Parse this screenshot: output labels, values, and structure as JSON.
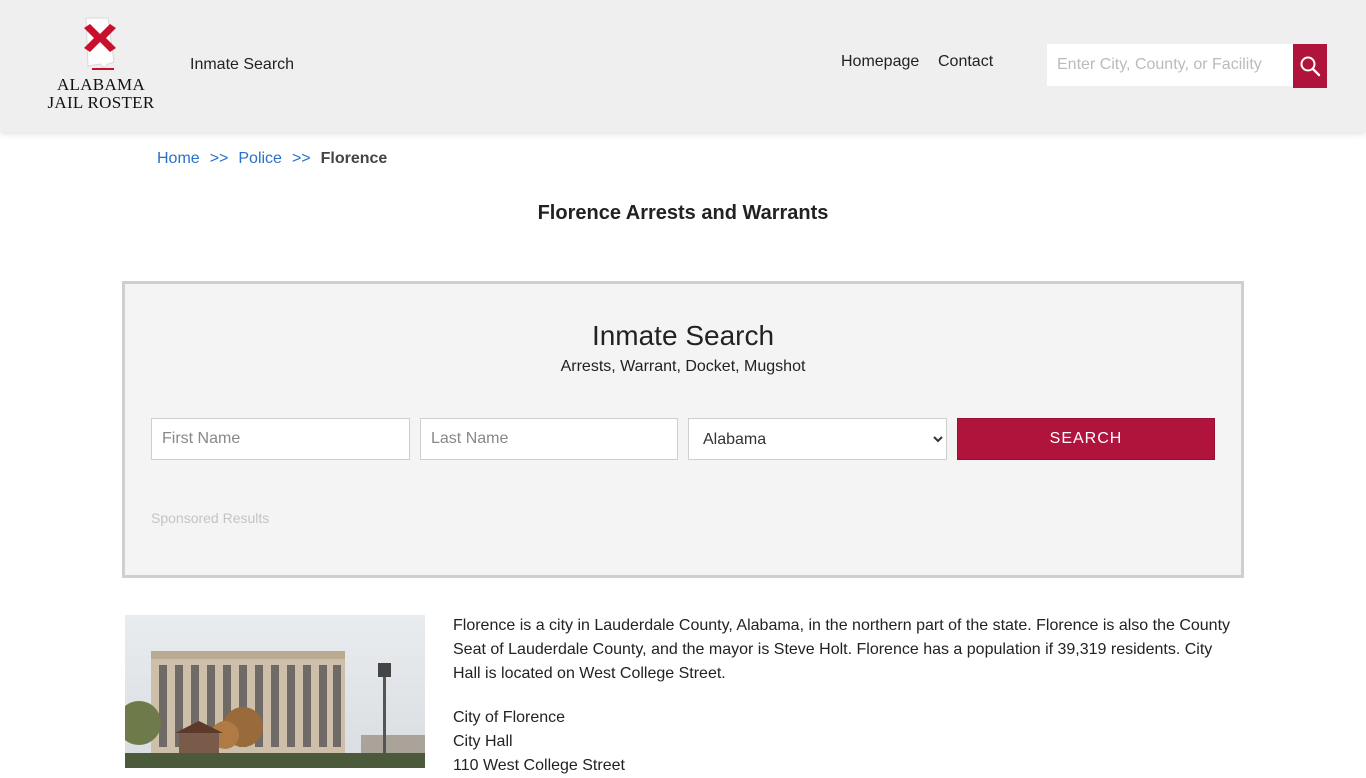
{
  "header": {
    "logo_line1": "ALABAMA",
    "logo_line2": "JAIL ROSTER",
    "nav_inmate_search": "Inmate Search",
    "nav_homepage": "Homepage",
    "nav_contact": "Contact",
    "search_placeholder": "Enter City, County, or Facility",
    "search_icon": "magnifier-icon"
  },
  "breadcrumb": {
    "home": "Home",
    "sep": ">>",
    "police": "Police",
    "current": "Florence"
  },
  "page_title": "Florence Arrests and Warrants",
  "search_panel": {
    "title": "Inmate Search",
    "subtitle": "Arrests, Warrant, Docket, Mugshot",
    "first_name_placeholder": "First Name",
    "last_name_placeholder": "Last Name",
    "state_selected": "Alabama",
    "search_label": "SEARCH",
    "sponsored": "Sponsored Results"
  },
  "content": {
    "paragraph": "Florence is a city in Lauderdale County, Alabama, in the northern part of the state. Florence is also the County Seat of Lauderdale County, and the mayor is Steve Holt. Florence has a population if 39,319 residents. City Hall is located on West College Street.",
    "address_lines": [
      "City of Florence",
      "City Hall",
      "110 West College Street"
    ]
  },
  "colors": {
    "accent": "#b0143c",
    "link": "#2a6fc9",
    "header_bg": "#efefef",
    "panel_bg": "#f4f4f4"
  }
}
